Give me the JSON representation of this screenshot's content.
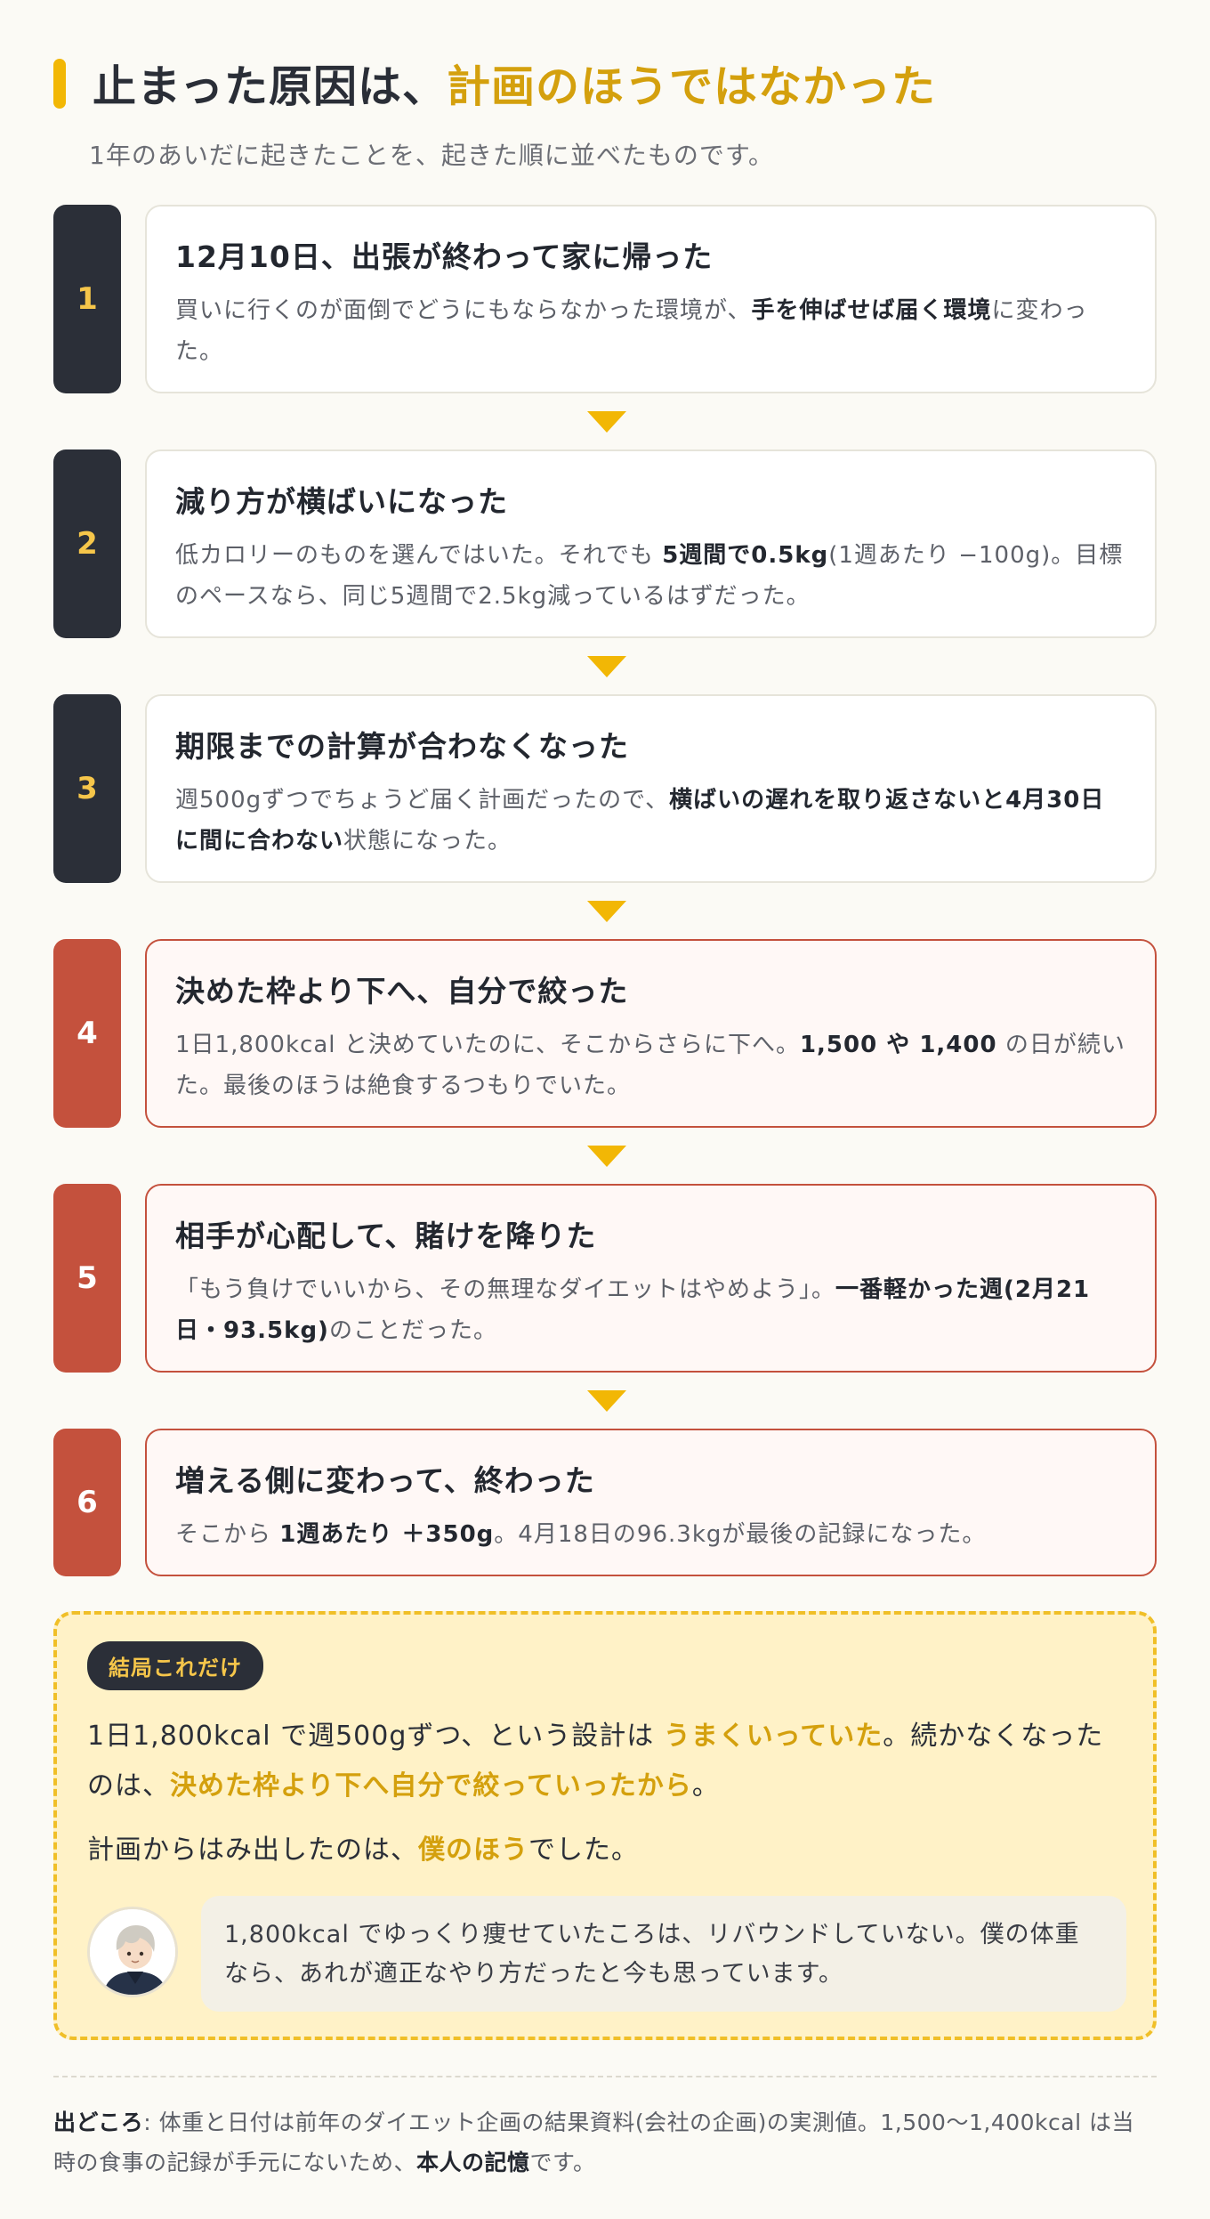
{
  "header": {
    "title_main": "止まった原因は、",
    "title_accent": "計画のほうではなかった",
    "subtitle": "1年のあいだに起きたことを、起きた順に並べたものです。"
  },
  "steps": [
    {
      "number": "1",
      "title": "12月10日、出張が終わって家に帰った",
      "text_a": "買いに行くのが面倒でどうにもならなかった環境が、",
      "text_b": "手を伸ばせば届く環境",
      "text_c": "に変わった。"
    },
    {
      "number": "2",
      "title": "減り方が横ばいになった",
      "text_a": "低カロリーのものを選んではいた。それでも ",
      "text_b": "5週間で0.5kg",
      "text_c": "(1週あたり −100g)。目標のペースなら、同じ5週間で2.5kg減っているはずだった。"
    },
    {
      "number": "3",
      "title": "期限までの計算が合わなくなった",
      "text_a": "週500gずつでちょうど届く計画だったので、",
      "text_b": "横ばいの遅れを取り返さないと4月30日に間に合わない",
      "text_c": "状態になった。"
    },
    {
      "number": "4",
      "title": "決めた枠より下へ、自分で絞った",
      "text_a": "1日1,800kcal と決めていたのに、そこからさらに下へ。",
      "text_b": "1,500 や 1,400",
      "text_c": " の日が続いた。最後のほうは絶食するつもりでいた。"
    },
    {
      "number": "5",
      "title": "相手が心配して、賭けを降りた",
      "text_a": "「もう負けでいいから、その無理なダイエットはやめよう」。",
      "text_b": "一番軽かった週(2月21日・93.5kg)",
      "text_c": "のことだった。"
    },
    {
      "number": "6",
      "title": "増える側に変わって、終わった",
      "text_a": "そこから ",
      "text_b": "1週あたり ＋350g",
      "text_c": "。4月18日の96.3kgが最後の記録になった。"
    }
  ],
  "summary": {
    "pill": "結局これだけ",
    "line1_a": "1日1,800kcal で週500gずつ、という設計は ",
    "line1_b": "うまくいっていた",
    "line1_c": "。続かなくなったのは、",
    "line1_d": "決めた枠より下へ自分で絞っていったから",
    "line1_e": "。",
    "line2_a": "計画からはみ出したのは、",
    "line2_b": "僕のほう",
    "line2_c": "でした。",
    "quote": "1,800kcal でゆっくり痩せていたころは、リバウンドしていない。僕の体重なら、あれが適正なやり方だったと今も思っています。"
  },
  "source": {
    "label": "出どころ",
    "text_a": ": 体重と日付は前年のダイエット企画の結果資料(会社の企画)の実測値。1,500〜1,400kcal は当時の食事の記録が手元にないため、",
    "text_b": "本人の記憶",
    "text_c": "です。"
  },
  "colors": {
    "accent": "#f2b705",
    "accent_text": "#d4a00d",
    "dark": "#2b2f38",
    "red": "#c4513d",
    "summary_bg": "#fff2c7"
  }
}
